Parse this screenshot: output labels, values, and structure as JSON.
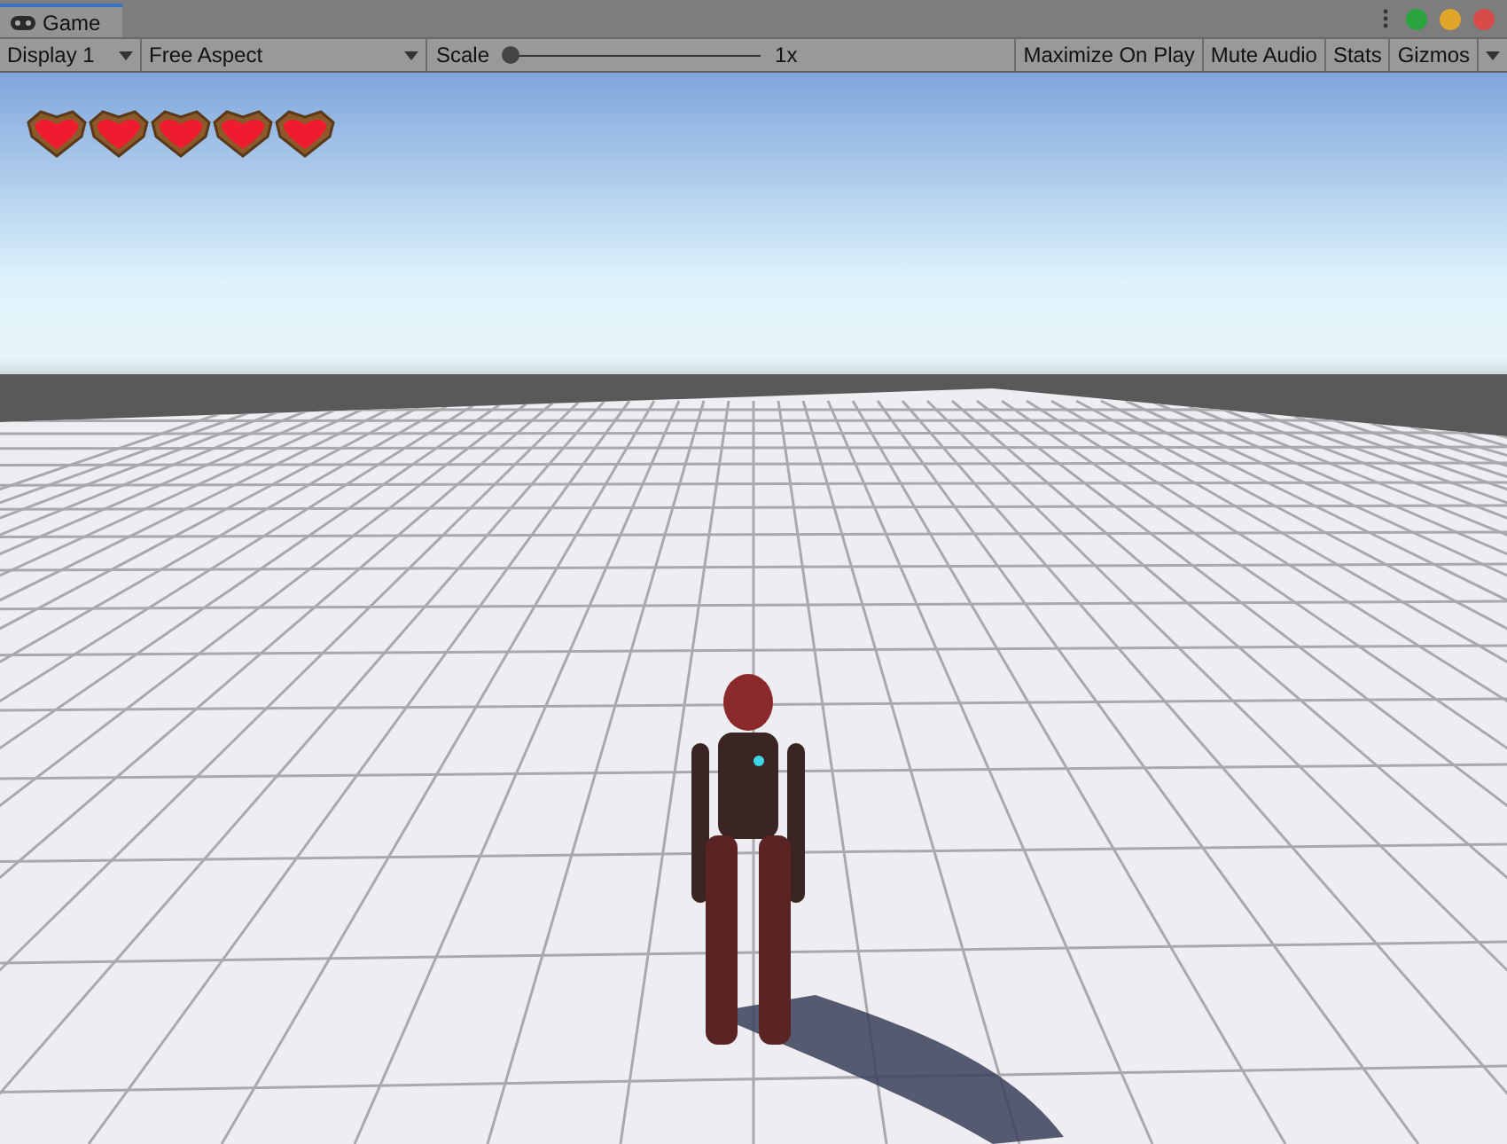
{
  "window": {
    "tabs": [
      {
        "label": "Game",
        "selected": true
      }
    ]
  },
  "toolbar": {
    "display": {
      "value": "Display 1"
    },
    "aspect": {
      "value": "Free Aspect"
    },
    "scale": {
      "label": "Scale",
      "level": 0,
      "reading": "1x"
    },
    "toggles": [
      {
        "label": "Maximize On Play",
        "on": false
      },
      {
        "label": "Mute Audio",
        "on": false
      },
      {
        "label": "Stats",
        "on": false
      },
      {
        "label": "Gizmos",
        "on": false
      }
    ]
  },
  "hud": {
    "hearts": [
      {
        "filled": true
      },
      {
        "filled": true
      },
      {
        "filled": true
      },
      {
        "filled": true
      },
      {
        "filled": true
      }
    ]
  }
}
